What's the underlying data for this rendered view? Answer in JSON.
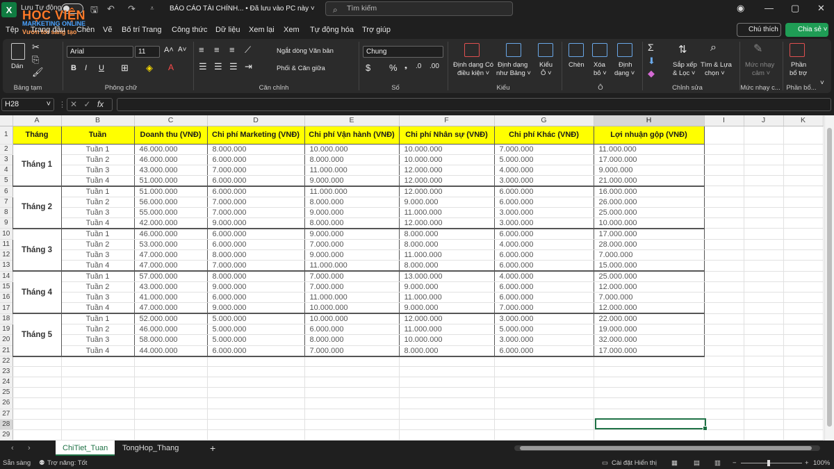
{
  "titlebar": {
    "autosave_label": "Lưu Tự động",
    "doc_title": "BÁO CÁO TÀI CHÍNH... • Đã lưu vào PC này ˅",
    "search_placeholder": "Tìm kiếm",
    "watermark_main": "HỌC VIỆN",
    "watermark_sub1": "MARKETING ONLINE",
    "watermark_sub2": "Vươn tới sáng tạo"
  },
  "menu": {
    "items": [
      "Tệp",
      "Trang đầu",
      "Chèn",
      "Vẽ",
      "Bố trí Trang",
      "Công thức",
      "Dữ liệu",
      "Xem lại",
      "Xem",
      "Tự động hóa",
      "Trợ giúp"
    ],
    "comment_label": "Chú thích",
    "share_label": "Chia sẻ ˅"
  },
  "ribbon": {
    "clipboard": {
      "label": "Bảng tạm",
      "paste": "Dán"
    },
    "font": {
      "label": "Phông chữ",
      "name": "Arial",
      "size": "11"
    },
    "alignment": {
      "label": "Căn chỉnh",
      "wrap": "Ngắt dòng Văn bản",
      "merge": "Phối & Căn giữa"
    },
    "number": {
      "label": "Số",
      "format": "Chung"
    },
    "styles": {
      "label": "Kiểu",
      "cond_1": "Định dạng Có",
      "cond_2": "điều kiện ˅",
      "table_1": "Định dạng",
      "table_2": "như Bảng ˅",
      "cell_1": "Kiểu",
      "cell_2": "Ô ˅"
    },
    "cells": {
      "label": "Ô",
      "insert": "Chèn",
      "delete_1": "Xóa",
      "delete_2": "bỏ ˅",
      "format_1": "Định",
      "format_2": "dạng ˅"
    },
    "editing": {
      "label": "Chỉnh sửa",
      "sort_1": "Sắp xếp",
      "sort_2": "& Lọc ˅",
      "find_1": "Tìm & Lựa",
      "find_2": "chọn ˅"
    },
    "sensitivity": {
      "label": "Mức nhạy c...",
      "btn_1": "Mức nhạy",
      "btn_2": "cảm ˅"
    },
    "addins": {
      "label": "Phần bổ...",
      "btn_1": "Phần",
      "btn_2": "bổ trợ"
    }
  },
  "formula_bar": {
    "name_box": "H28",
    "fx": "fx"
  },
  "sheet": {
    "columns": [
      "A",
      "B",
      "C",
      "D",
      "E",
      "F",
      "G",
      "H",
      "I",
      "J",
      "K"
    ],
    "headers": [
      "Tháng",
      "Tuần",
      "Doanh thu (VNĐ)",
      "Chi phí Marketing (VNĐ)",
      "Chi phí Vận hành (VNĐ)",
      "Chi phí Nhân sự (VNĐ)",
      "Chi phí Khác (VNĐ)",
      "Lợi nhuận gộp (VNĐ)"
    ],
    "months": [
      "Tháng 1",
      "Tháng 2",
      "Tháng 3",
      "Tháng 4",
      "Tháng 5"
    ],
    "rows": [
      [
        "Tuần 1",
        "46.000.000",
        "8.000.000",
        "10.000.000",
        "10.000.000",
        "7.000.000",
        "11.000.000"
      ],
      [
        "Tuần 2",
        "46.000.000",
        "6.000.000",
        "8.000.000",
        "10.000.000",
        "5.000.000",
        "17.000.000"
      ],
      [
        "Tuần 3",
        "43.000.000",
        "7.000.000",
        "11.000.000",
        "12.000.000",
        "4.000.000",
        "9.000.000"
      ],
      [
        "Tuần 4",
        "51.000.000",
        "6.000.000",
        "9.000.000",
        "12.000.000",
        "3.000.000",
        "21.000.000"
      ],
      [
        "Tuần 1",
        "51.000.000",
        "6.000.000",
        "11.000.000",
        "12.000.000",
        "6.000.000",
        "16.000.000"
      ],
      [
        "Tuần 2",
        "56.000.000",
        "7.000.000",
        "8.000.000",
        "9.000.000",
        "6.000.000",
        "26.000.000"
      ],
      [
        "Tuần 3",
        "55.000.000",
        "7.000.000",
        "9.000.000",
        "11.000.000",
        "3.000.000",
        "25.000.000"
      ],
      [
        "Tuần 4",
        "42.000.000",
        "9.000.000",
        "8.000.000",
        "12.000.000",
        "3.000.000",
        "10.000.000"
      ],
      [
        "Tuần 1",
        "46.000.000",
        "6.000.000",
        "9.000.000",
        "8.000.000",
        "6.000.000",
        "17.000.000"
      ],
      [
        "Tuần 2",
        "53.000.000",
        "6.000.000",
        "7.000.000",
        "8.000.000",
        "4.000.000",
        "28.000.000"
      ],
      [
        "Tuần 3",
        "47.000.000",
        "8.000.000",
        "9.000.000",
        "11.000.000",
        "6.000.000",
        "7.000.000"
      ],
      [
        "Tuần 4",
        "47.000.000",
        "7.000.000",
        "11.000.000",
        "8.000.000",
        "6.000.000",
        "15.000.000"
      ],
      [
        "Tuần 1",
        "57.000.000",
        "8.000.000",
        "7.000.000",
        "13.000.000",
        "4.000.000",
        "25.000.000"
      ],
      [
        "Tuần 2",
        "43.000.000",
        "9.000.000",
        "7.000.000",
        "9.000.000",
        "6.000.000",
        "12.000.000"
      ],
      [
        "Tuần 3",
        "41.000.000",
        "6.000.000",
        "11.000.000",
        "11.000.000",
        "6.000.000",
        "7.000.000"
      ],
      [
        "Tuần 4",
        "47.000.000",
        "9.000.000",
        "10.000.000",
        "9.000.000",
        "7.000.000",
        "12.000.000"
      ],
      [
        "Tuần 1",
        "52.000.000",
        "5.000.000",
        "10.000.000",
        "12.000.000",
        "3.000.000",
        "22.000.000"
      ],
      [
        "Tuần 2",
        "46.000.000",
        "5.000.000",
        "6.000.000",
        "11.000.000",
        "5.000.000",
        "19.000.000"
      ],
      [
        "Tuần 3",
        "58.000.000",
        "5.000.000",
        "8.000.000",
        "10.000.000",
        "3.000.000",
        "32.000.000"
      ],
      [
        "Tuần 4",
        "44.000.000",
        "6.000.000",
        "7.000.000",
        "8.000.000",
        "6.000.000",
        "17.000.000"
      ]
    ],
    "row_count": 29
  },
  "tabs": {
    "active": "ChiTiet_Tuan",
    "other": "TongHop_Thang",
    "add": "+"
  },
  "status": {
    "ready": "Sẵn sàng",
    "accessibility": "Trợ năng: Tốt",
    "display_settings": "Cài đặt Hiển thị",
    "zoom": "100%"
  },
  "colors": {
    "header_fill": "#ffff00",
    "accent": "#1e7145",
    "share": "#1f9d55"
  }
}
